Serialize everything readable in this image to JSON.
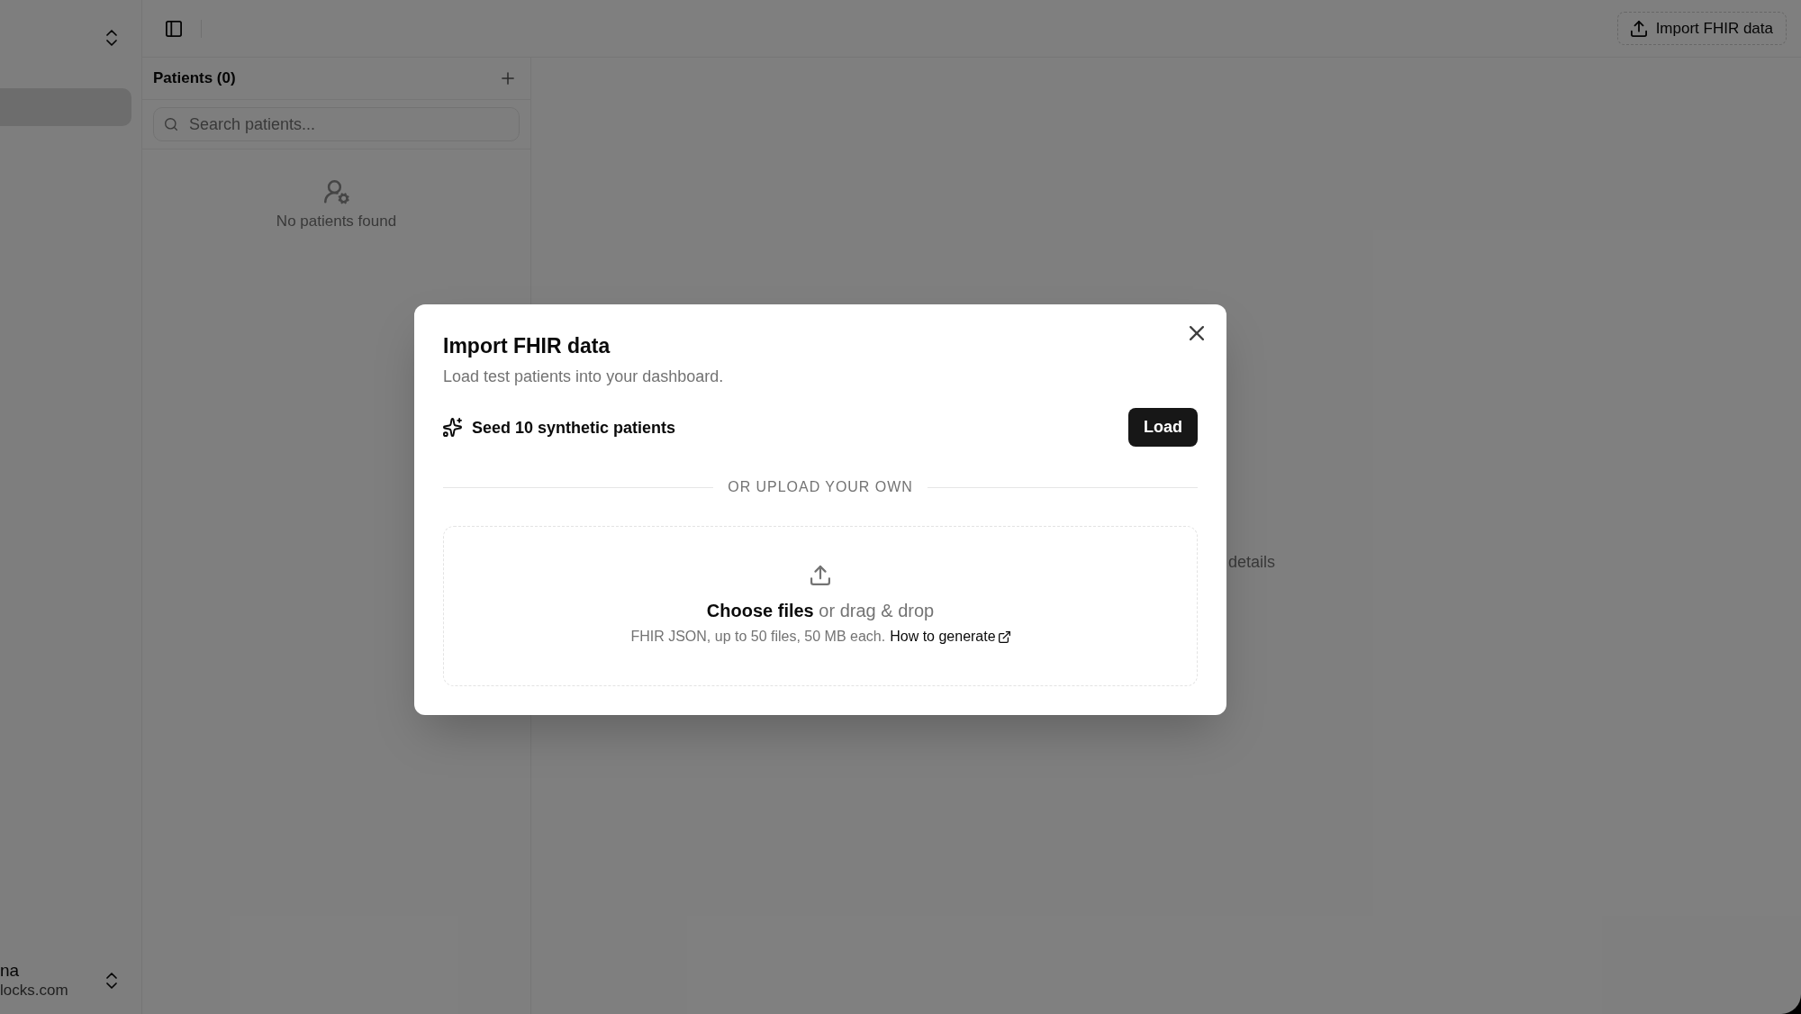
{
  "sidebar": {
    "nav_items": [
      {
        "selected": true
      }
    ],
    "account": {
      "name": "na",
      "email": "locks.com"
    }
  },
  "topbar": {
    "import_button": {
      "label": "Import FHIR data"
    }
  },
  "patients_panel": {
    "title": "Patients (0)",
    "search": {
      "placeholder": "Search patients..."
    },
    "empty_message": "No patients found"
  },
  "detail_pane": {
    "message": "details"
  },
  "dialog": {
    "title": "Import FHIR data",
    "description": "Load test patients into your dashboard.",
    "seed": {
      "label": "Seed 10 synthetic patients",
      "button": "Load"
    },
    "divider": "OR UPLOAD YOUR OWN",
    "dropzone": {
      "prompt": "**Choose files** or drag & drop",
      "hint": "FHIR JSON, up to 50 files, 50 MB each.",
      "link": "How to generate"
    }
  }
}
